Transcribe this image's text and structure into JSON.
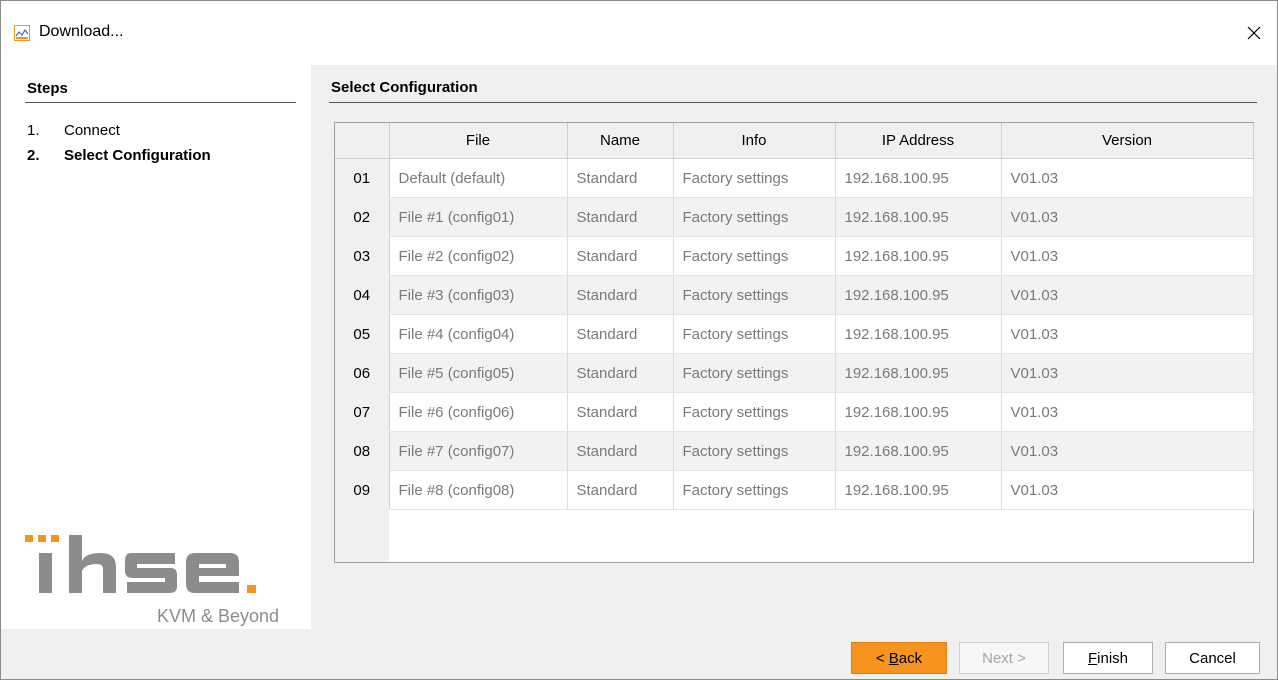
{
  "window": {
    "title": "Download..."
  },
  "steps": {
    "header": "Steps",
    "items": [
      {
        "num": "1.",
        "label": "Connect"
      },
      {
        "num": "2.",
        "label": "Select Configuration"
      }
    ]
  },
  "logo": {
    "text": "ihse",
    "tagline": "KVM & Beyond",
    "accent": "#f7941d"
  },
  "main": {
    "header": "Select Configuration"
  },
  "table": {
    "columns": [
      "File",
      "Name",
      "Info",
      "IP Address",
      "Version"
    ],
    "rows": [
      {
        "id": "01",
        "file": "Default (default)",
        "name": "Standard",
        "info": "Factory settings",
        "ip": "192.168.100.95",
        "version": "V01.03"
      },
      {
        "id": "02",
        "file": "File #1 (config01)",
        "name": "Standard",
        "info": "Factory settings",
        "ip": "192.168.100.95",
        "version": "V01.03"
      },
      {
        "id": "03",
        "file": "File #2 (config02)",
        "name": "Standard",
        "info": "Factory settings",
        "ip": "192.168.100.95",
        "version": "V01.03"
      },
      {
        "id": "04",
        "file": "File #3 (config03)",
        "name": "Standard",
        "info": "Factory settings",
        "ip": "192.168.100.95",
        "version": "V01.03"
      },
      {
        "id": "05",
        "file": "File #4 (config04)",
        "name": "Standard",
        "info": "Factory settings",
        "ip": "192.168.100.95",
        "version": "V01.03"
      },
      {
        "id": "06",
        "file": "File #5 (config05)",
        "name": "Standard",
        "info": "Factory settings",
        "ip": "192.168.100.95",
        "version": "V01.03"
      },
      {
        "id": "07",
        "file": "File #6 (config06)",
        "name": "Standard",
        "info": "Factory settings",
        "ip": "192.168.100.95",
        "version": "V01.03"
      },
      {
        "id": "08",
        "file": "File #7 (config07)",
        "name": "Standard",
        "info": "Factory settings",
        "ip": "192.168.100.95",
        "version": "V01.03"
      },
      {
        "id": "09",
        "file": "File #8 (config08)",
        "name": "Standard",
        "info": "Factory settings",
        "ip": "192.168.100.95",
        "version": "V01.03"
      }
    ]
  },
  "buttons": {
    "back": {
      "label": "< Back",
      "mnemonic": "B"
    },
    "next": {
      "label": "Next >"
    },
    "finish": {
      "label": "Finish",
      "mnemonic": "F"
    },
    "cancel": {
      "label": "Cancel"
    }
  }
}
